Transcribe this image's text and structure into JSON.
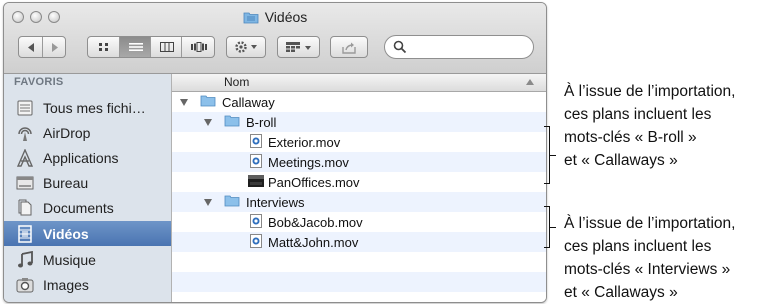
{
  "window": {
    "title": "Vidéos"
  },
  "toolbar": {
    "search_placeholder": ""
  },
  "sidebar": {
    "heading": "FAVORIS",
    "items": [
      {
        "label": "Tous mes fichi…",
        "icon": "all-files-icon"
      },
      {
        "label": "AirDrop",
        "icon": "airdrop-icon"
      },
      {
        "label": "Applications",
        "icon": "applications-icon"
      },
      {
        "label": "Bureau",
        "icon": "desktop-icon"
      },
      {
        "label": "Documents",
        "icon": "documents-icon"
      },
      {
        "label": "Vidéos",
        "icon": "movies-icon",
        "selected": true
      },
      {
        "label": "Musique",
        "icon": "music-icon"
      },
      {
        "label": "Images",
        "icon": "camera-icon"
      }
    ]
  },
  "list": {
    "column_header": "Nom",
    "rows": [
      {
        "label": "Callaway",
        "kind": "folder",
        "level": 0,
        "expanded": true
      },
      {
        "label": "B-roll",
        "kind": "folder",
        "level": 1,
        "expanded": true
      },
      {
        "label": "Exterior.mov",
        "kind": "mov",
        "level": 2
      },
      {
        "label": "Meetings.mov",
        "kind": "mov",
        "level": 2
      },
      {
        "label": "PanOffices.mov",
        "kind": "mov-dark",
        "level": 2
      },
      {
        "label": "Interviews",
        "kind": "folder",
        "level": 1,
        "expanded": true
      },
      {
        "label": "Bob&Jacob.mov",
        "kind": "mov",
        "level": 2
      },
      {
        "label": "Matt&John.mov",
        "kind": "mov",
        "level": 2
      }
    ]
  },
  "annotations": {
    "broll": [
      "À l’issue de l’importation,",
      "ces plans incluent les",
      "mots-clés « B-roll »",
      "et « Callaways »"
    ],
    "interviews": [
      "À l’issue de l’importation,",
      "ces plans incluent les",
      "mots-clés « Interviews »",
      "et « Callaways »"
    ]
  }
}
